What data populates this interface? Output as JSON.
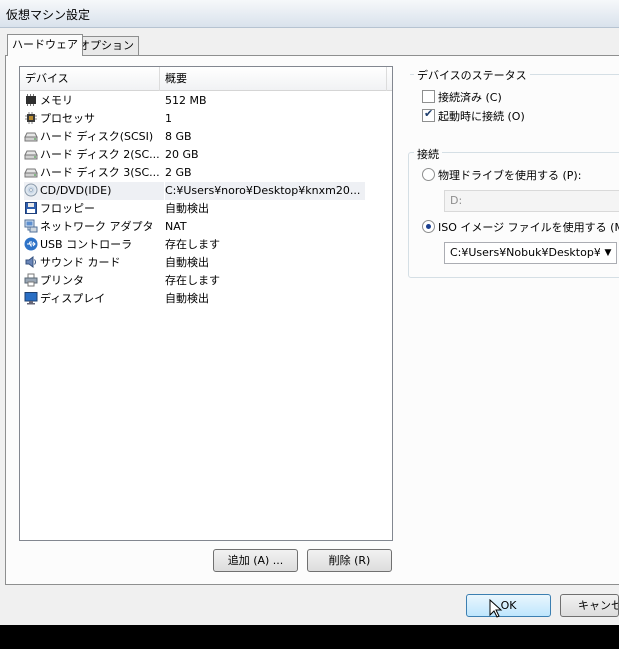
{
  "window": {
    "title": "仮想マシン設定"
  },
  "tabs": [
    {
      "label": "ハードウェア",
      "active": true
    },
    {
      "label": "オプション",
      "active": false
    }
  ],
  "device_list": {
    "columns": [
      "デバイス",
      "概要"
    ],
    "rows": [
      {
        "icon": "memory-icon",
        "device": "メモリ",
        "summary": "512 MB"
      },
      {
        "icon": "processor-icon",
        "device": "プロセッサ",
        "summary": "1"
      },
      {
        "icon": "hard-disk-icon",
        "device": "ハード ディスク(SCSI)",
        "summary": "8 GB"
      },
      {
        "icon": "hard-disk-icon",
        "device": "ハード ディスク 2(SC...",
        "summary": "20 GB"
      },
      {
        "icon": "hard-disk-icon",
        "device": "ハード ディスク 3(SC...",
        "summary": "2 GB"
      },
      {
        "icon": "cd-dvd-icon",
        "device": "CD/DVD(IDE)",
        "summary": "C:¥Users¥noro¥Desktop¥knxm20...",
        "selected": true
      },
      {
        "icon": "floppy-icon",
        "device": "フロッピー",
        "summary": "自動検出"
      },
      {
        "icon": "network-adapter-icon",
        "device": "ネットワーク アダプタ",
        "summary": "NAT"
      },
      {
        "icon": "usb-icon",
        "device": "USB コントローラ",
        "summary": "存在します"
      },
      {
        "icon": "sound-card-icon",
        "device": "サウンド カード",
        "summary": "自動検出"
      },
      {
        "icon": "printer-icon",
        "device": "プリンタ",
        "summary": "存在します"
      },
      {
        "icon": "display-icon",
        "device": "ディスプレイ",
        "summary": "自動検出"
      }
    ]
  },
  "buttons": {
    "add": "追加 (A) ...",
    "remove": "削除 (R)",
    "ok": "OK",
    "cancel": "キャンセル"
  },
  "device_status": {
    "title": "デバイスのステータス",
    "connected": {
      "label": "接続済み (C)",
      "checked": false
    },
    "connect_at_power_on": {
      "label": "起動時に接続 (O)",
      "checked": true
    }
  },
  "connection": {
    "title": "接続",
    "physical_drive": {
      "label": "物理ドライブを使用する (P):",
      "selected": false,
      "value": "D:"
    },
    "iso_image": {
      "label": "ISO イメージ ファイルを使用する (M):",
      "selected": true,
      "value": "C:¥Users¥Nobuk¥Desktop¥'"
    }
  },
  "colors": {
    "accent": "#3c7fb1",
    "taskbar": "#000000"
  }
}
